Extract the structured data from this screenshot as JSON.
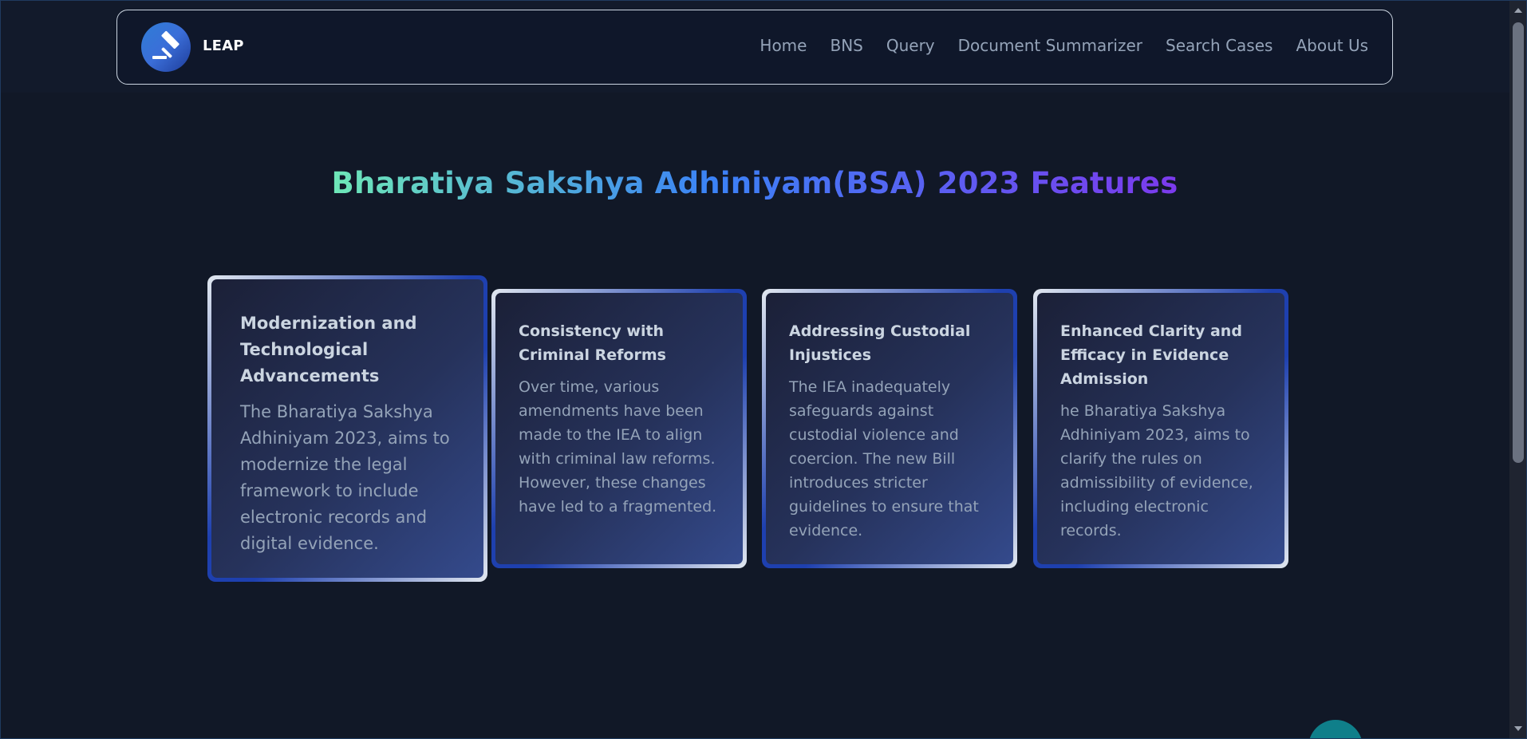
{
  "brand": {
    "name": "LEAP",
    "logo_icon": "gavel-icon"
  },
  "nav": {
    "items": [
      "Home",
      "BNS",
      "Query",
      "Document Summarizer",
      "Search Cases",
      "About Us"
    ]
  },
  "page_title": "Bharatiya Sakshya Adhiniyam(BSA) 2023 Features",
  "cards": [
    {
      "title": "Modernization and Technological Advancements",
      "body": "The Bharatiya Sakshya Adhiniyam 2023, aims to modernize the legal framework to include electronic records and digital evidence."
    },
    {
      "title": "Consistency with Criminal Reforms",
      "body": "Over time, various amendments have been made to the IEA to align with criminal law reforms. However, these changes have led to a fragmented."
    },
    {
      "title": "Addressing Custodial Injustices",
      "body": "The IEA inadequately safeguards against custodial violence and coercion. The new Bill introduces stricter guidelines to ensure that evidence."
    },
    {
      "title": "Enhanced Clarity and Efficacy in Evidence Admission",
      "body": "he Bharatiya Sakshya Adhiniyam 2023, aims to clarify the rules on admissibility of evidence, including electronic records."
    }
  ],
  "colors": {
    "background": "#111827",
    "title_gradient": [
      "#6ee7b7",
      "#3b82f6",
      "#7c3aed"
    ],
    "fab": "#0f7f8a"
  }
}
